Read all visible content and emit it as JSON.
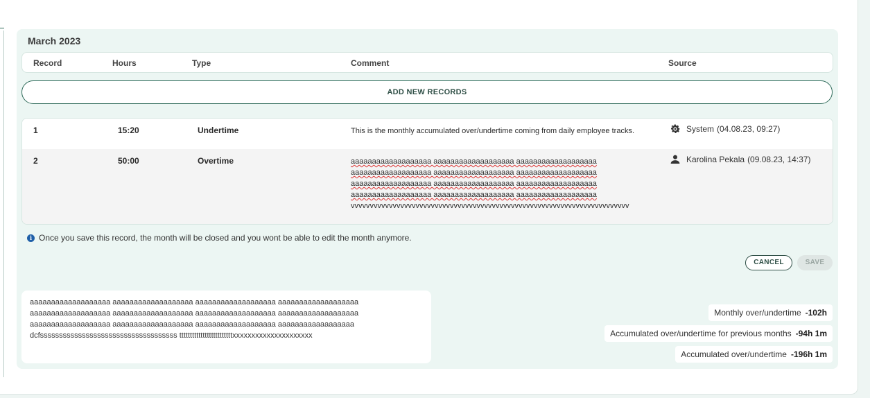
{
  "month": "March 2023",
  "columns": {
    "record": "Record",
    "hours": "Hours",
    "type": "Type",
    "comment": "Comment",
    "source": "Source"
  },
  "add_button": "ADD NEW RECORDS",
  "records": [
    {
      "record": "1",
      "hours": "15:20",
      "type": "Undertime",
      "comment": "This is the monthly accumulated over/undertime  coming from daily employee tracks.",
      "source_icon": "gear-icon",
      "source": "System",
      "source_time": "(04.08.23, 09:27)"
    },
    {
      "record": "2",
      "hours": "50:00",
      "type": "Overtime",
      "comment_lines": [
        "aaaaaaaaaaaaaaaaaaa aaaaaaaaaaaaaaaaaaa aaaaaaaaaaaaaaaaaaa",
        "aaaaaaaaaaaaaaaaaaa aaaaaaaaaaaaaaaaaaa aaaaaaaaaaaaaaaaaaa",
        "aaaaaaaaaaaaaaaaaaa aaaaaaaaaaaaaaaaaaa aaaaaaaaaaaaaaaaaaa",
        "aaaaaaaaaaaaaaaaaaa aaaaaaaaaaaaaaaaaaa aaaaaaaaaaaaaaaaaaa"
      ],
      "comment_tail": "vvvvvvvvvvvvvvvvvvvvvvvvvvvvvvvvvvvvvvvvvvvvvvvvvvvvvvvvvvvvvvvvvvvvvvvvv",
      "source_icon": "user-icon",
      "source": "Karolina Pekala",
      "source_time": "(09.08.23, 14:37)"
    }
  ],
  "info_text": "Once you save this record, the month will be closed and you wont be able to edit the month anymore.",
  "cancel_label": "CANCEL",
  "save_label": "SAVE",
  "note_lines": [
    "aaaaaaaaaaaaaaaaaaa aaaaaaaaaaaaaaaaaaa aaaaaaaaaaaaaaaaaaa aaaaaaaaaaaaaaaaaaa",
    "aaaaaaaaaaaaaaaaaaa aaaaaaaaaaaaaaaaaaa aaaaaaaaaaaaaaaaaaa aaaaaaaaaaaaaaaaaaa",
    "aaaaaaaaaaaaaaaaaaa aaaaaaaaaaaaaaaaaaa aaaaaaaaaaaaaaaaaaa aaaaaaaaaaaaaaaaaa",
    "dcfssssssssssssssssssssssssssssssssssss tttttttttttttttttttttttttxxxxxxxxxxxxxxxxxxxxx"
  ],
  "summary": {
    "monthly_label": "Monthly over/undertime",
    "monthly_value": "-102h",
    "prev_label": "Accumulated over/undertime for previous months",
    "prev_value": "-94h 1m",
    "acc_label": "Accumulated over/undertime",
    "acc_value": "-196h 1m"
  }
}
